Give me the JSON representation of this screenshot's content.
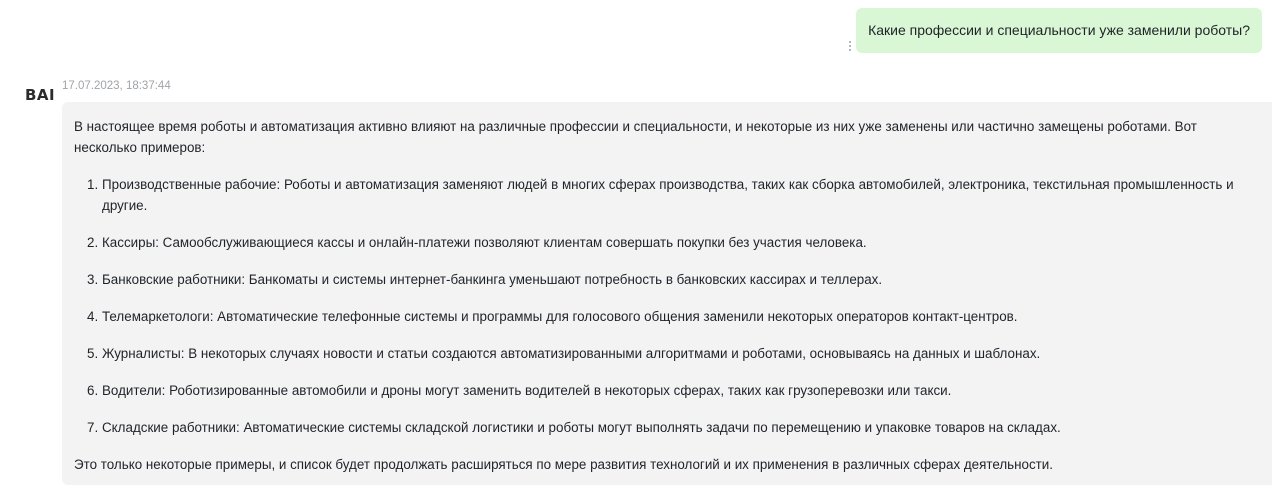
{
  "user_message": {
    "text": "Какие профессии и специальности уже заменили роботы?"
  },
  "bot_message": {
    "logo_text": "BAI",
    "timestamp": "17.07.2023, 18:37:44",
    "intro": "В настоящее время роботы и автоматизация активно влияют на различные профессии и специальности, и некоторые из них уже заменены или частично замещены роботами. Вот несколько примеров:",
    "items": [
      {
        "num": "1.",
        "text": "Производственные рабочие: Роботы и автоматизация заменяют людей в многих сферах производства, таких как сборка автомобилей, электроника, текстильная промышленность и другие."
      },
      {
        "num": "2.",
        "text": "Кассиры: Самообслуживающиеся кассы и онлайн-платежи позволяют клиентам совершать покупки без участия человека."
      },
      {
        "num": "3.",
        "text": "Банковские работники: Банкоматы и системы интернет-банкинга уменьшают потребность в банковских кассирах и теллерах."
      },
      {
        "num": "4.",
        "text": "Телемаркетологи: Автоматические телефонные системы и программы для голосового общения заменили некоторых операторов контакт-центров."
      },
      {
        "num": "5.",
        "text": "Журналисты: В некоторых случаях новости и статьи создаются автоматизированными алгоритмами и роботами, основываясь на данных и шаблонах."
      },
      {
        "num": "6.",
        "text": "Водители: Роботизированные автомобили и дроны могут заменить водителей в некоторых сферах, таких как грузоперевозки или такси."
      },
      {
        "num": "7.",
        "text": "Складские работники: Автоматические системы складской логистики и роботы могут выполнять задачи по перемещению и упаковке товаров на складах."
      }
    ],
    "outro": "Это только некоторые примеры, и список будет продолжать расширяться по мере развития технологий и их применения в различных сферах деятельности."
  },
  "colors": {
    "user_bubble": "#d9f7d4",
    "bot_bubble": "#f3f3f4",
    "timestamp": "#a0a4a8"
  },
  "icons": {
    "message_menu": "more-vertical-icon"
  }
}
